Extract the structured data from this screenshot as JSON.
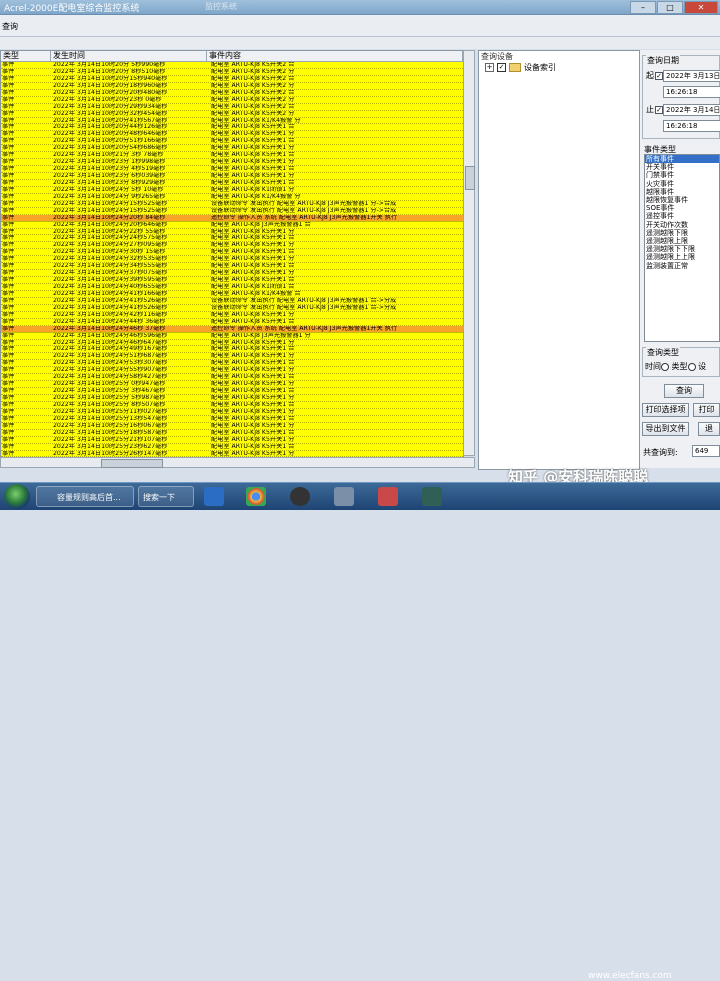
{
  "window": {
    "title": "Acrel-2000E配电室综合监控系统",
    "background_title": "监控系统"
  },
  "menu": {
    "label": "查询"
  },
  "grid": {
    "columns": [
      "类型",
      "发生时间",
      "事件内容"
    ],
    "rows": [
      {
        "type": "事件",
        "time": "2022年 3月14日10时20分 5秒990毫秒",
        "content": "配电室 ARTU-KJ8 K5开关2 合",
        "alarm": false
      },
      {
        "type": "事件",
        "time": "2022年 3月14日10时20分 8秒510毫秒",
        "content": "配电室 ARTU-KJ8 K5开关2 分",
        "alarm": false
      },
      {
        "type": "事件",
        "time": "2022年 3月14日10时20分15秒940毫秒",
        "content": "配电室 ARTU-KJ8 K5开关2 合",
        "alarm": false
      },
      {
        "type": "事件",
        "time": "2022年 3月14日10时20分18秒960毫秒",
        "content": "配电室 ARTU-KJ8 K5开关2 分",
        "alarm": false
      },
      {
        "type": "事件",
        "time": "2022年 3月14日10时20分20秒480毫秒",
        "content": "配电室 ARTU-KJ8 K5开关2 合",
        "alarm": false
      },
      {
        "type": "事件",
        "time": "2022年 3月14日10时20分23秒 0毫秒",
        "content": "配电室 ARTU-KJ8 K5开关2 分",
        "alarm": false
      },
      {
        "type": "事件",
        "time": "2022年 3月14日10时20分29秒934毫秒",
        "content": "配电室 ARTU-KJ8 K5开关2 合",
        "alarm": false
      },
      {
        "type": "事件",
        "time": "2022年 3月14日10时20分32秒454毫秒",
        "content": "配电室 ARTU-KJ8 K5开关2 分",
        "alarm": false
      },
      {
        "type": "事件",
        "time": "2022年 3月14日10时20分41秒567毫秒",
        "content": "配电室 ARTU-KJ8 K1/K4报警 分",
        "alarm": false
      },
      {
        "type": "事件",
        "time": "2022年 3月14日10时20分44秒126毫秒",
        "content": "配电室 ARTU-KJ8 K5开关1 合",
        "alarm": false
      },
      {
        "type": "事件",
        "time": "2022年 3月14日10时20分48秒646毫秒",
        "content": "配电室 ARTU-KJ8 K5开关1 分",
        "alarm": false
      },
      {
        "type": "事件",
        "time": "2022年 3月14日10时20分51秒166毫秒",
        "content": "配电室 ARTU-KJ8 K5开关1 合",
        "alarm": false
      },
      {
        "type": "事件",
        "time": "2022年 3月14日10时20分54秒686毫秒",
        "content": "配电室 ARTU-KJ8 K5开关1 分",
        "alarm": false
      },
      {
        "type": "事件",
        "time": "2022年 3月14日10时21分 3秒 78毫秒",
        "content": "配电室 ARTU-KJ8 K5开关1 合",
        "alarm": false
      },
      {
        "type": "事件",
        "time": "2022年 3月14日10时23分 1秒998毫秒",
        "content": "配电室 ARTU-KJ8 K5开关1 分",
        "alarm": false
      },
      {
        "type": "事件",
        "time": "2022年 3月14日10时23分 4秒519毫秒",
        "content": "配电室 ARTU-KJ8 K5开关1 合",
        "alarm": false
      },
      {
        "type": "事件",
        "time": "2022年 3月14日10时23分 6秒039毫秒",
        "content": "配电室 ARTU-KJ8 K5开关1 分",
        "alarm": false
      },
      {
        "type": "事件",
        "time": "2022年 3月14日10时23分 8秒929毫秒",
        "content": "配电室 ARTU-KJ8 K5开关1 合",
        "alarm": false
      },
      {
        "type": "事件",
        "time": "2022年 3月14日10时24分 5秒 10毫秒",
        "content": "配电室 ARTU-KJ8 K1闭锁1 分",
        "alarm": false
      },
      {
        "type": "事件",
        "time": "2022年 3月14日10时24分 9秒265毫秒",
        "content": "配电室 ARTU-KJ8 K1/K4报警 分",
        "alarm": false
      },
      {
        "type": "事件",
        "time": "2022年 3月14日10时24分15秒525毫秒",
        "content": "设备联动命令 发出执行 配电室 ARTU-KJ8 J3声光报警器1 分->合成",
        "alarm": false
      },
      {
        "type": "事件",
        "time": "2022年 3月14日10时24分15秒525毫秒",
        "content": "设备联动命令 发出执行 配电室 ARTU-KJ8 J3声光报警器1 分->合成",
        "alarm": false
      },
      {
        "type": "事件",
        "time": "2022年 3月14日10时24分20秒 84毫秒",
        "content": "遥控命令 操作人员 系统 配电室 ARTU-KJ8 J3声光报警器1开关 执行",
        "alarm": true
      },
      {
        "type": "事件",
        "time": "2022年 3月14日10时24分20秒646毫秒",
        "content": "配电室 ARTU-KJ8 J3声光报警器1 合",
        "alarm": false
      },
      {
        "type": "事件",
        "time": "2022年 3月14日10时24分22秒 55毫秒",
        "content": "配电室 ARTU-KJ8 K5开关1 分",
        "alarm": false
      },
      {
        "type": "事件",
        "time": "2022年 3月14日10时24分24秒575毫秒",
        "content": "配电室 ARTU-KJ8 K5开关1 合",
        "alarm": false
      },
      {
        "type": "事件",
        "time": "2022年 3月14日10时24分27秒095毫秒",
        "content": "配电室 ARTU-KJ8 K5开关1 分",
        "alarm": false
      },
      {
        "type": "事件",
        "time": "2022年 3月14日10时24分30秒 15毫秒",
        "content": "配电室 ARTU-KJ8 K5开关1 合",
        "alarm": false
      },
      {
        "type": "事件",
        "time": "2022年 3月14日10时24分32秒535毫秒",
        "content": "配电室 ARTU-KJ8 K5开关1 分",
        "alarm": false
      },
      {
        "type": "事件",
        "time": "2022年 3月14日10时24分34秒555毫秒",
        "content": "配电室 ARTU-KJ8 K5开关1 合",
        "alarm": false
      },
      {
        "type": "事件",
        "time": "2022年 3月14日10时24分37秒075毫秒",
        "content": "配电室 ARTU-KJ8 K5开关1 分",
        "alarm": false
      },
      {
        "type": "事件",
        "time": "2022年 3月14日10时24分39秒595毫秒",
        "content": "配电室 ARTU-KJ8 K5开关1 合",
        "alarm": false
      },
      {
        "type": "事件",
        "time": "2022年 3月14日10时24分40秒655毫秒",
        "content": "配电室 ARTU-KJ8 K1闭锁1 合",
        "alarm": false
      },
      {
        "type": "事件",
        "time": "2022年 3月14日10时24分41秒166毫秒",
        "content": "配电室 ARTU-KJ8 K1/K4报警 合",
        "alarm": false
      },
      {
        "type": "事件",
        "time": "2022年 3月14日10时24分41秒526毫秒",
        "content": "设备联动命令 发出执行 配电室 ARTU-KJ8 J3声光报警器1 合->分成",
        "alarm": false
      },
      {
        "type": "事件",
        "time": "2022年 3月14日10时24分41秒526毫秒",
        "content": "设备联动命令 发出执行 配电室 ARTU-KJ8 J3声光报警器1 合->分成",
        "alarm": false
      },
      {
        "type": "事件",
        "time": "2022年 3月14日10时24分42秒116毫秒",
        "content": "配电室 ARTU-KJ8 K5开关1 分",
        "alarm": false
      },
      {
        "type": "事件",
        "time": "2022年 3月14日10时24分44秒 36毫秒",
        "content": "配电室 ARTU-KJ8 K5开关1 合",
        "alarm": false
      },
      {
        "type": "事件",
        "time": "2022年 3月14日10时24分46秒 37毫秒",
        "content": "遥控命令 操作人员 系统 配电室 ARTU-KJ8 J3声光报警器1开关 执行",
        "alarm": true
      },
      {
        "type": "事件",
        "time": "2022年 3月14日10时24分46秒596毫秒",
        "content": "配电室 ARTU-KJ8 J3声光报警器1 分",
        "alarm": false
      },
      {
        "type": "事件",
        "time": "2022年 3月14日10时24分46秒647毫秒",
        "content": "配电室 ARTU-KJ8 K5开关1 分",
        "alarm": false
      },
      {
        "type": "事件",
        "time": "2022年 3月14日10时24分49秒167毫秒",
        "content": "配电室 ARTU-KJ8 K5开关1 合",
        "alarm": false
      },
      {
        "type": "事件",
        "time": "2022年 3月14日10时24分51秒687毫秒",
        "content": "配电室 ARTU-KJ8 K5开关1 分",
        "alarm": false
      },
      {
        "type": "事件",
        "time": "2022年 3月14日10时24分53秒307毫秒",
        "content": "配电室 ARTU-KJ8 K5开关1 合",
        "alarm": false
      },
      {
        "type": "事件",
        "time": "2022年 3月14日10时24分55秒907毫秒",
        "content": "配电室 ARTU-KJ8 K5开关1 分",
        "alarm": false
      },
      {
        "type": "事件",
        "time": "2022年 3月14日10时24分58秒427毫秒",
        "content": "配电室 ARTU-KJ8 K5开关1 合",
        "alarm": false
      },
      {
        "type": "事件",
        "time": "2022年 3月14日10时25分 0秒947毫秒",
        "content": "配电室 ARTU-KJ8 K5开关1 分",
        "alarm": false
      },
      {
        "type": "事件",
        "time": "2022年 3月14日10时25分 3秒467毫秒",
        "content": "配电室 ARTU-KJ8 K5开关1 合",
        "alarm": false
      },
      {
        "type": "事件",
        "time": "2022年 3月14日10时25分 5秒987毫秒",
        "content": "配电室 ARTU-KJ8 K5开关1 分",
        "alarm": false
      },
      {
        "type": "事件",
        "time": "2022年 3月14日10时25分 8秒507毫秒",
        "content": "配电室 ARTU-KJ8 K5开关1 合",
        "alarm": false
      },
      {
        "type": "事件",
        "time": "2022年 3月14日10时25分11秒027毫秒",
        "content": "配电室 ARTU-KJ8 K5开关1 分",
        "alarm": false
      },
      {
        "type": "事件",
        "time": "2022年 3月14日10时25分13秒547毫秒",
        "content": "配电室 ARTU-KJ8 K5开关1 合",
        "alarm": false
      },
      {
        "type": "事件",
        "time": "2022年 3月14日10时25分16秒067毫秒",
        "content": "配电室 ARTU-KJ8 K5开关1 分",
        "alarm": false
      },
      {
        "type": "事件",
        "time": "2022年 3月14日10时25分18秒587毫秒",
        "content": "配电室 ARTU-KJ8 K5开关1 合",
        "alarm": false
      },
      {
        "type": "事件",
        "time": "2022年 3月14日10时25分21秒107毫秒",
        "content": "配电室 ARTU-KJ8 K5开关1 分",
        "alarm": false
      },
      {
        "type": "事件",
        "time": "2022年 3月14日10时25分23秒627毫秒",
        "content": "配电室 ARTU-KJ8 K5开关1 合",
        "alarm": false
      },
      {
        "type": "事件",
        "time": "2022年 3月14日10时25分26秒147毫秒",
        "content": "配电室 ARTU-KJ8 K5开关1 分",
        "alarm": false
      }
    ]
  },
  "tree": {
    "header": "查询设备",
    "expander": "+",
    "checkbox": "✓",
    "node_label": "设备索引"
  },
  "query_date": {
    "group_label": "查询日期",
    "start_label": "起:",
    "start_date": "2022年 3月13日",
    "start_time": "16:26:18",
    "end_label": "止:",
    "end_date": "2022年 3月14日",
    "end_time": "16:26:18",
    "checkmark": "✓"
  },
  "event_types": {
    "group_label": "事件类型",
    "items": [
      "所有事件",
      "开关事件",
      "门禁事件",
      "火灾事件",
      "越限事件",
      "越限恢复事件",
      "SOE事件",
      "遥控事件",
      "开关动作次数",
      "遥测越限下限",
      "遥测越限上限",
      "遥测越限下下限",
      "遥测越限上上限",
      "监测装置正常"
    ],
    "selected_index": 0
  },
  "query_type": {
    "group_label": "查询类型",
    "options": [
      "时间",
      "类型",
      "设"
    ]
  },
  "buttons": {
    "query": "查询",
    "print_selected": "打印选择项",
    "print": "打印",
    "export": "导出到文件",
    "exit": "退"
  },
  "count": {
    "label": "共查询到:",
    "value": "649"
  },
  "taskbar": {
    "task1": "容量规则高后首...",
    "task2": "搜索一下"
  },
  "watermark": {
    "text": "知乎 @安科瑞陈聪聪",
    "site": "www.elecfans.com"
  },
  "colors": {
    "row_bg": "#ffff00",
    "alarm_row_bg": "#f7a428",
    "selected": "#3470c8"
  }
}
